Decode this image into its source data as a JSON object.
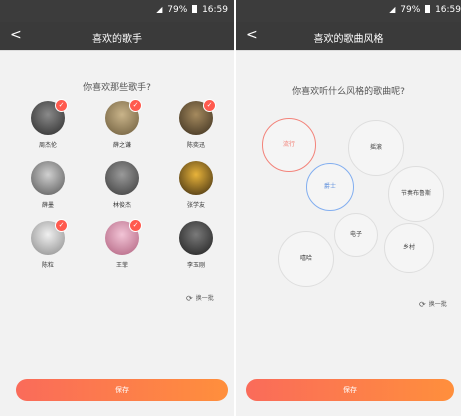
{
  "status": {
    "signal": "◢",
    "battery_pct": "79%",
    "time": "16:59"
  },
  "left": {
    "back": "<",
    "title": "喜欢的歌手",
    "question": "你喜欢那些歌手?",
    "singers": [
      {
        "name": "周杰伦",
        "selected": true
      },
      {
        "name": "薛之谦",
        "selected": true
      },
      {
        "name": "陈奕迅",
        "selected": true
      },
      {
        "name": "薛墨",
        "selected": false
      },
      {
        "name": "林俊杰",
        "selected": false
      },
      {
        "name": "张学友",
        "selected": false
      },
      {
        "name": "陈粒",
        "selected": true
      },
      {
        "name": "王菲",
        "selected": true
      },
      {
        "name": "李玉刚",
        "selected": false
      }
    ],
    "refresh": "换一批",
    "save": "保存"
  },
  "right": {
    "back": "<",
    "title": "喜欢的歌曲风格",
    "question": "你喜欢听什么风格的歌曲呢?",
    "styles": [
      "流行",
      "摇滚",
      "爵士",
      "节奏布鲁斯",
      "电子",
      "嘻哈",
      "乡村"
    ],
    "refresh": "换一批",
    "save": "保存"
  },
  "colors": {
    "accent_red": "#ff5a4e",
    "gradient_start": "#fa6b5a",
    "gradient_end": "#ff8f3c",
    "selected_blue": "#82aef0",
    "nav_bg": "#3a3a3a"
  },
  "icons": {
    "check": "✓",
    "refresh": "⟳"
  }
}
